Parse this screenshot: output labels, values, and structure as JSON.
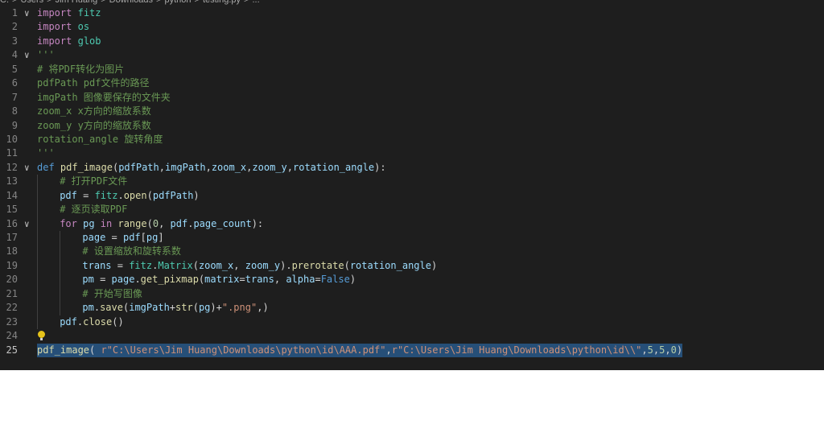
{
  "breadcrumb": {
    "parts": [
      "C:",
      ">",
      "Users",
      ">",
      "Jim Huang",
      ">",
      "Downloads",
      ">",
      "python",
      ">",
      "testing.py",
      ">",
      "..."
    ]
  },
  "lines": [
    {
      "n": "1",
      "fold": "∨",
      "tokens": [
        [
          "kw",
          "import"
        ],
        [
          "pun",
          " "
        ],
        [
          "mod",
          "fitz"
        ]
      ]
    },
    {
      "n": "2",
      "tokens": [
        [
          "kw",
          "import"
        ],
        [
          "pun",
          " "
        ],
        [
          "mod",
          "os"
        ]
      ]
    },
    {
      "n": "3",
      "tokens": [
        [
          "kw",
          "import"
        ],
        [
          "pun",
          " "
        ],
        [
          "mod",
          "glob"
        ]
      ]
    },
    {
      "n": "4",
      "fold": "∨",
      "tokens": [
        [
          "doc",
          "'''"
        ]
      ]
    },
    {
      "n": "5",
      "tokens": [
        [
          "doc",
          "# 将PDF转化为图片"
        ]
      ]
    },
    {
      "n": "6",
      "tokens": [
        [
          "doc",
          "pdfPath pdf文件的路径"
        ]
      ]
    },
    {
      "n": "7",
      "tokens": [
        [
          "doc",
          "imgPath 图像要保存的文件夹"
        ]
      ]
    },
    {
      "n": "8",
      "tokens": [
        [
          "doc",
          "zoom_x x方向的缩放系数"
        ]
      ]
    },
    {
      "n": "9",
      "tokens": [
        [
          "doc",
          "zoom_y y方向的缩放系数"
        ]
      ]
    },
    {
      "n": "10",
      "tokens": [
        [
          "doc",
          "rotation_angle 旋转角度"
        ]
      ]
    },
    {
      "n": "11",
      "tokens": [
        [
          "doc",
          "'''"
        ]
      ]
    },
    {
      "n": "12",
      "fold": "∨",
      "tokens": [
        [
          "kb",
          "def"
        ],
        [
          "pun",
          " "
        ],
        [
          "fn",
          "pdf_image"
        ],
        [
          "pun",
          "("
        ],
        [
          "var",
          "pdfPath"
        ],
        [
          "pun",
          ","
        ],
        [
          "var",
          "imgPath"
        ],
        [
          "pun",
          ","
        ],
        [
          "var",
          "zoom_x"
        ],
        [
          "pun",
          ","
        ],
        [
          "var",
          "zoom_y"
        ],
        [
          "pun",
          ","
        ],
        [
          "var",
          "rotation_angle"
        ],
        [
          "pun",
          "):"
        ]
      ]
    },
    {
      "n": "13",
      "indent": 1,
      "tokens": [
        [
          "com",
          "# 打开PDF文件"
        ]
      ]
    },
    {
      "n": "14",
      "indent": 1,
      "tokens": [
        [
          "var",
          "pdf"
        ],
        [
          "pun",
          " = "
        ],
        [
          "mod",
          "fitz"
        ],
        [
          "pun",
          "."
        ],
        [
          "fn",
          "open"
        ],
        [
          "pun",
          "("
        ],
        [
          "var",
          "pdfPath"
        ],
        [
          "pun",
          ")"
        ]
      ]
    },
    {
      "n": "15",
      "indent": 1,
      "tokens": [
        [
          "com",
          "# 逐页读取PDF"
        ]
      ]
    },
    {
      "n": "16",
      "indent": 1,
      "fold": "∨",
      "tokens": [
        [
          "kw",
          "for"
        ],
        [
          "pun",
          " "
        ],
        [
          "var",
          "pg"
        ],
        [
          "pun",
          " "
        ],
        [
          "kw",
          "in"
        ],
        [
          "pun",
          " "
        ],
        [
          "fn",
          "range"
        ],
        [
          "pun",
          "("
        ],
        [
          "num",
          "0"
        ],
        [
          "pun",
          ", "
        ],
        [
          "var",
          "pdf"
        ],
        [
          "pun",
          "."
        ],
        [
          "var",
          "page_count"
        ],
        [
          "pun",
          "):"
        ]
      ]
    },
    {
      "n": "17",
      "indent": 2,
      "tokens": [
        [
          "var",
          "page"
        ],
        [
          "pun",
          " = "
        ],
        [
          "var",
          "pdf"
        ],
        [
          "pun",
          "["
        ],
        [
          "var",
          "pg"
        ],
        [
          "pun",
          "]"
        ]
      ]
    },
    {
      "n": "18",
      "indent": 2,
      "tokens": [
        [
          "com",
          "# 设置缩放和旋转系数"
        ]
      ]
    },
    {
      "n": "19",
      "indent": 2,
      "tokens": [
        [
          "var",
          "trans"
        ],
        [
          "pun",
          " = "
        ],
        [
          "mod",
          "fitz"
        ],
        [
          "pun",
          "."
        ],
        [
          "mod",
          "Matrix"
        ],
        [
          "pun",
          "("
        ],
        [
          "var",
          "zoom_x"
        ],
        [
          "pun",
          ", "
        ],
        [
          "var",
          "zoom_y"
        ],
        [
          "pun",
          ")."
        ],
        [
          "fn",
          "prerotate"
        ],
        [
          "pun",
          "("
        ],
        [
          "var",
          "rotation_angle"
        ],
        [
          "pun",
          ")"
        ]
      ]
    },
    {
      "n": "20",
      "indent": 2,
      "tokens": [
        [
          "var",
          "pm"
        ],
        [
          "pun",
          " = "
        ],
        [
          "var",
          "page"
        ],
        [
          "pun",
          "."
        ],
        [
          "fn",
          "get_pixmap"
        ],
        [
          "pun",
          "("
        ],
        [
          "var",
          "matrix"
        ],
        [
          "pun",
          "="
        ],
        [
          "var",
          "trans"
        ],
        [
          "pun",
          ", "
        ],
        [
          "var",
          "alpha"
        ],
        [
          "pun",
          "="
        ],
        [
          "kb",
          "False"
        ],
        [
          "pun",
          ")"
        ]
      ]
    },
    {
      "n": "21",
      "indent": 2,
      "tokens": [
        [
          "com",
          "# 开始写图像"
        ]
      ]
    },
    {
      "n": "22",
      "indent": 2,
      "tokens": [
        [
          "var",
          "pm"
        ],
        [
          "pun",
          "."
        ],
        [
          "fn",
          "save"
        ],
        [
          "pun",
          "("
        ],
        [
          "var",
          "imgPath"
        ],
        [
          "pun",
          "+"
        ],
        [
          "fn",
          "str"
        ],
        [
          "pun",
          "("
        ],
        [
          "var",
          "pg"
        ],
        [
          "pun",
          ")+"
        ],
        [
          "str",
          "\".png\""
        ],
        [
          "pun",
          ",)"
        ]
      ]
    },
    {
      "n": "23",
      "indent": 1,
      "tokens": [
        [
          "var",
          "pdf"
        ],
        [
          "pun",
          "."
        ],
        [
          "fn",
          "close"
        ],
        [
          "pun",
          "()"
        ]
      ]
    },
    {
      "n": "24",
      "bulb": true,
      "tokens": []
    },
    {
      "n": "25",
      "active": true,
      "selected": true,
      "tokens": [
        [
          "fn",
          "pdf_image"
        ],
        [
          "pun",
          "( "
        ],
        [
          "str",
          "r\"C:\\Users\\Jim Huang\\Downloads\\python\\id\\AAA.pdf\""
        ],
        [
          "pun",
          ","
        ],
        [
          "str",
          "r\"C:\\Users\\Jim Huang\\Downloads\\python\\id\\\\\""
        ],
        [
          "pun",
          ","
        ],
        [
          "num",
          "5"
        ],
        [
          "pun",
          ","
        ],
        [
          "num",
          "5"
        ],
        [
          "pun",
          ","
        ],
        [
          "num",
          "0"
        ],
        [
          "pun",
          ")"
        ]
      ]
    }
  ]
}
